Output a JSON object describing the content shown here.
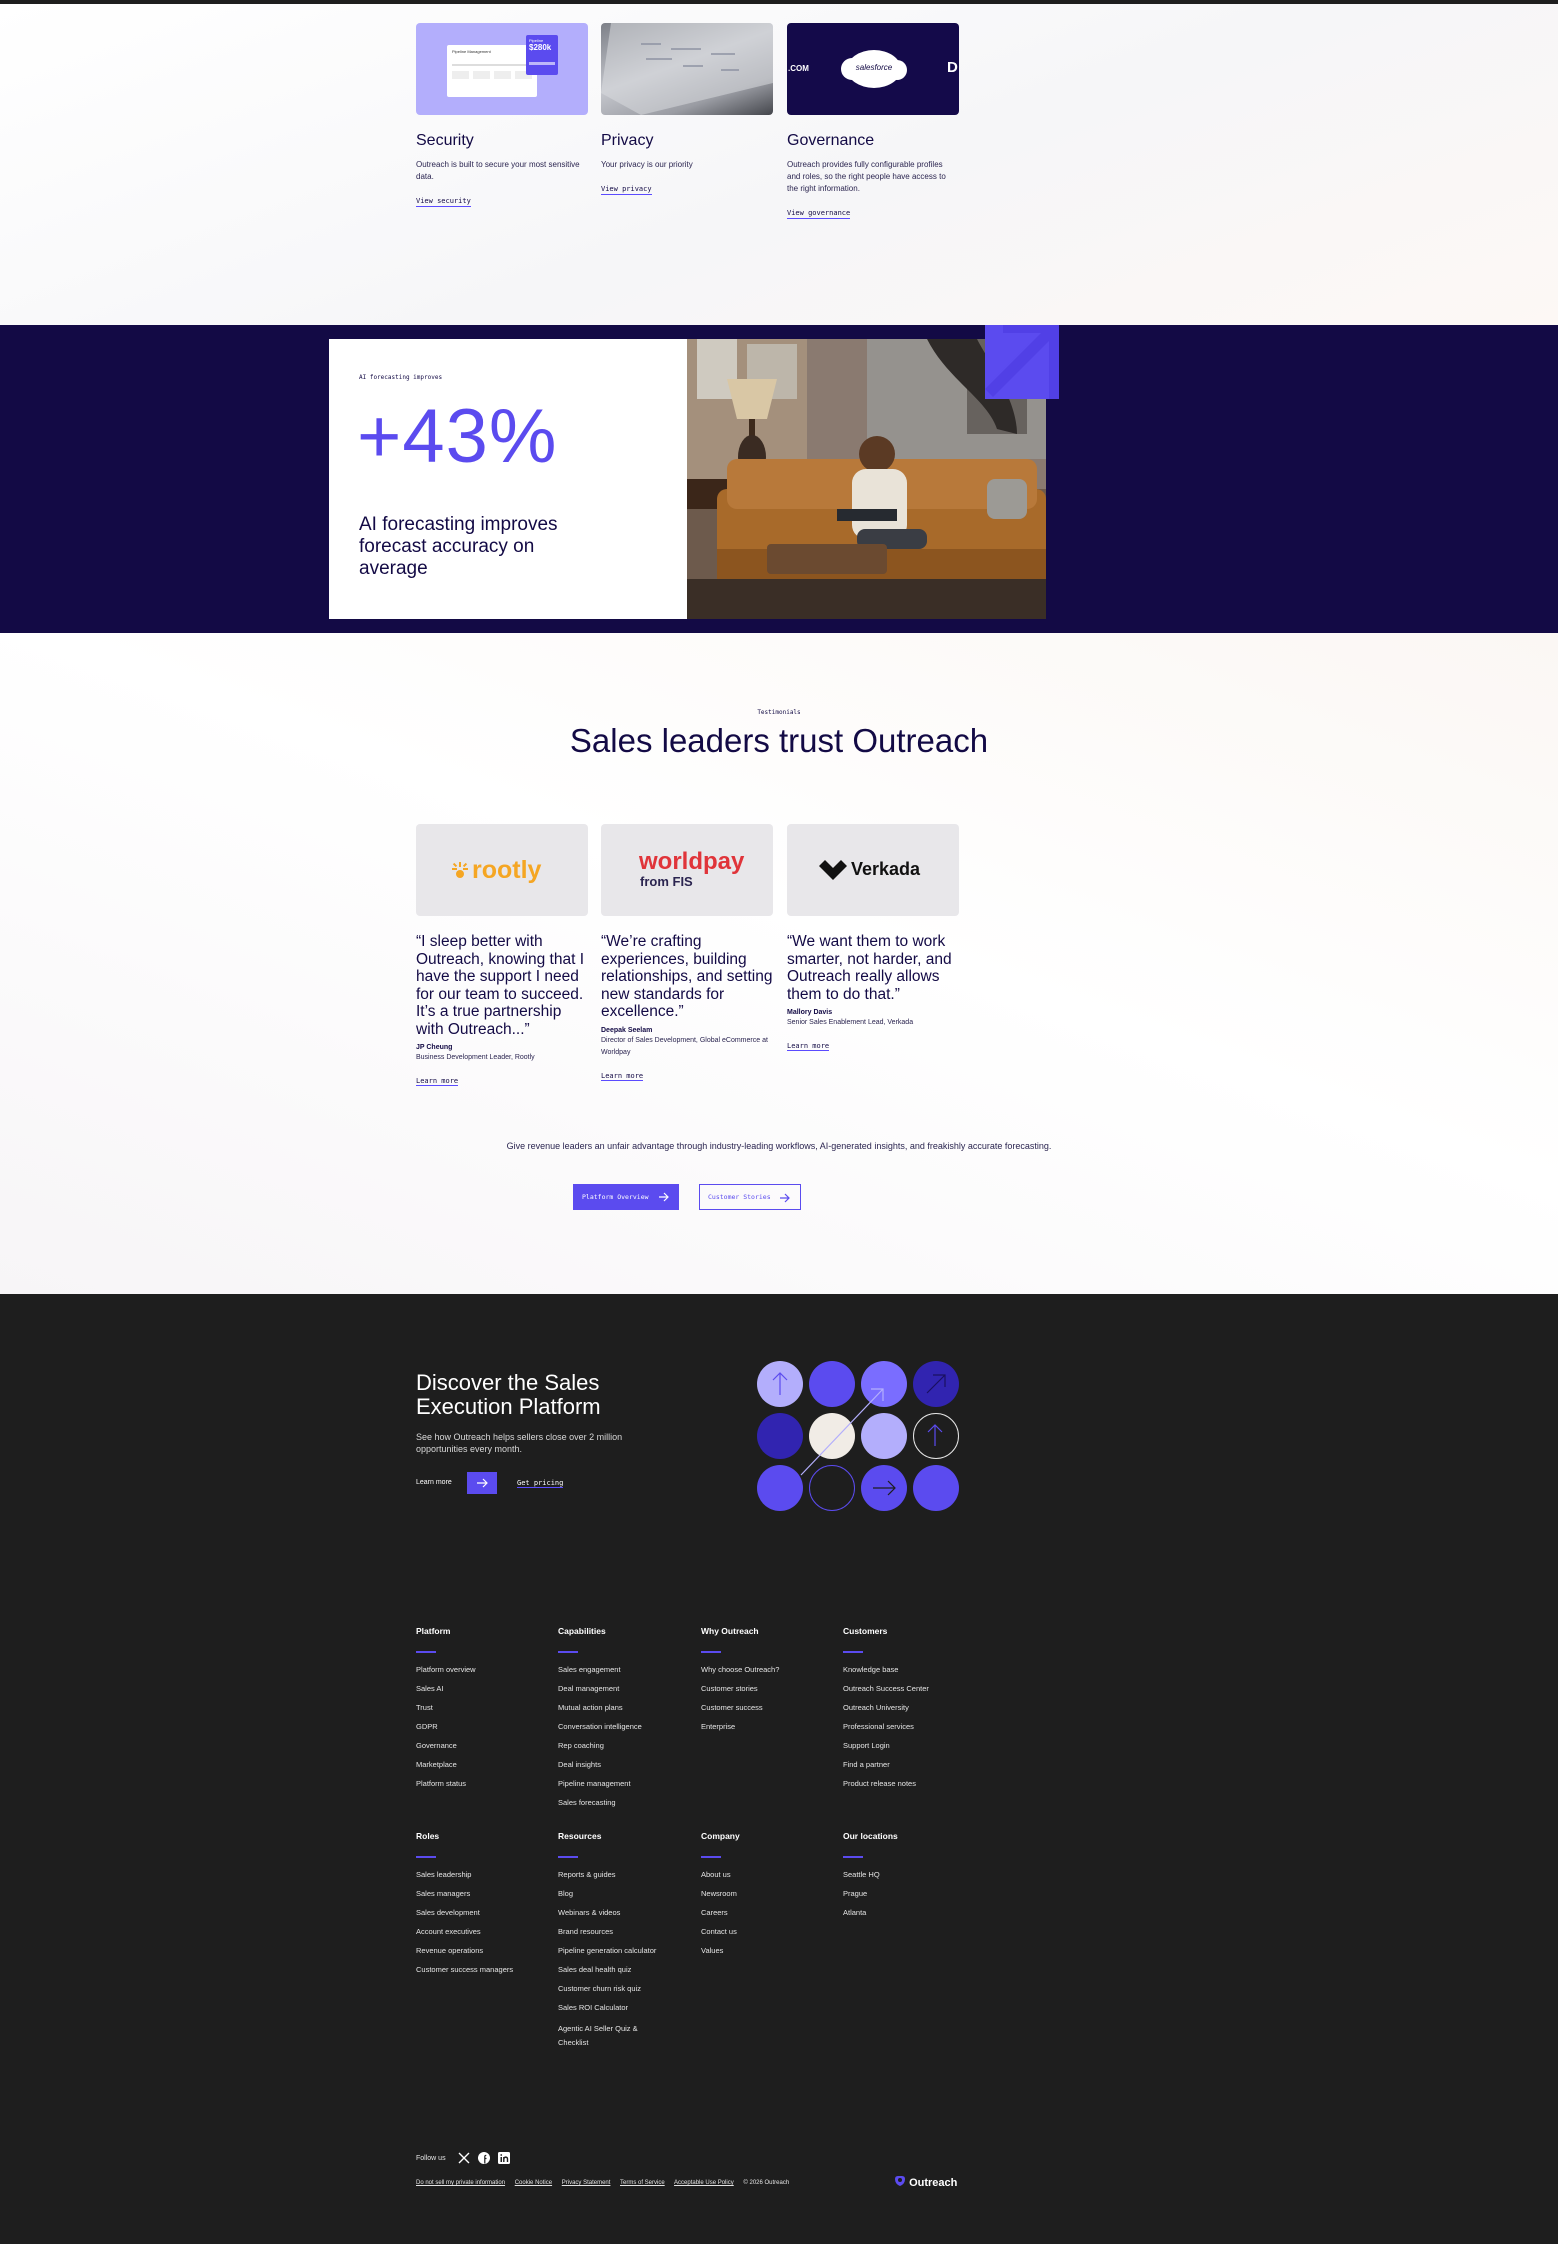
{
  "trust": {
    "cards": [
      {
        "title": "Security",
        "body": "Outreach is built to secure your most sensitive data.",
        "link": "View security"
      },
      {
        "title": "Privacy",
        "body": "Your privacy is our priority",
        "link": "View privacy"
      },
      {
        "title": "Governance",
        "body": "Outreach provides fully configurable profiles and roles, so the right people have access to the right information.",
        "link": "View governance"
      }
    ],
    "security_thumb": {
      "panel_title": "Pipeline Management",
      "amount": "$280k",
      "amount_label": "Pipeline"
    },
    "governance_thumb": {
      "left_text": ".COM",
      "logo_text": "salesforce",
      "right_text": "D"
    }
  },
  "stat": {
    "eyebrow": "AI forecasting improves",
    "value": "+43%",
    "description": "AI forecasting improves forecast accuracy on average"
  },
  "testimonials": {
    "eyebrow": "Testimonials",
    "heading": "Sales leaders trust Outreach",
    "items": [
      {
        "logo": "rootly",
        "quote": "“I sleep better with Outreach, knowing that I have the support I need for our team to succeed. It’s a true partnership with Outreach...”",
        "name": "JP Cheung",
        "role": "Business Development Leader, Rootly",
        "link": "Learn more"
      },
      {
        "logo": "worldpay",
        "logo_sub": "from FIS",
        "quote": "“We’re crafting experiences, building relationships, and setting new standards for excellence.”",
        "name": "Deepak Seelam",
        "role": "Director of Sales Development, Global eCommerce at Worldpay",
        "link": "Learn more"
      },
      {
        "logo": "Verkada",
        "quote": "“We want them to work smarter, not harder, and Outreach really allows them to do that.”",
        "name": "Mallory Davis",
        "role": "Senior Sales Enablement Lead, Verkada",
        "link": "Learn more"
      }
    ],
    "blurb": "Give revenue leaders an unfair advantage through industry-leading workflows, AI-generated insights, and freakishly accurate forecasting.",
    "primary_button": "Platform Overview",
    "secondary_button": "Customer Stories"
  },
  "footer": {
    "discover": {
      "heading": "Discover the Sales Execution Platform",
      "body": "See how Outreach helps sellers close over 2 million opportunities every month.",
      "learn_more": "Learn more",
      "pricing": "Get pricing"
    },
    "columns": [
      {
        "title": "Platform",
        "items": [
          "Platform overview",
          "Sales AI",
          "Trust",
          "GDPR",
          "Governance",
          "Marketplace",
          "Platform status"
        ]
      },
      {
        "title": "Capabilities",
        "items": [
          "Sales engagement",
          "Deal management",
          "Mutual action plans",
          "Conversation intelligence",
          "Rep coaching",
          "Deal insights",
          "Pipeline management",
          "Sales forecasting"
        ]
      },
      {
        "title": "Why Outreach",
        "items": [
          "Why choose Outreach?",
          "Customer stories",
          "Customer success",
          "Enterprise"
        ]
      },
      {
        "title": "Customers",
        "items": [
          "Knowledge base",
          "Outreach Success Center",
          "Outreach University",
          "Professional services",
          "Support Login",
          "Find a partner",
          "Product release notes"
        ]
      },
      {
        "title": "Roles",
        "items": [
          "Sales leadership",
          "Sales managers",
          "Sales development",
          "Account executives",
          "Revenue operations",
          "Customer success managers"
        ]
      },
      {
        "title": "Resources",
        "items": [
          "Reports & guides",
          "Blog",
          "Webinars & videos",
          "Brand resources",
          "Pipeline generation calculator",
          "Sales deal health quiz",
          "Customer churn risk quiz",
          "Sales ROI Calculator",
          "Agentic AI Seller Quiz & Checklist"
        ]
      },
      {
        "title": "Company",
        "items": [
          "About us",
          "Newsroom",
          "Careers",
          "Contact us",
          "Values"
        ]
      },
      {
        "title": "Our locations",
        "items": [
          "Seattle HQ",
          "Prague",
          "Atlanta"
        ]
      }
    ],
    "follow_label": "Follow us",
    "legal_links": [
      "Do not sell my private information",
      "Cookie Notice",
      "Privacy Statement",
      "Terms of Service",
      "Acceptable Use Policy"
    ],
    "copyright": "© 2026 Outreach",
    "brand": "Outreach"
  },
  "colors": {
    "accent": "#5b4bef",
    "navy": "#130a45",
    "footer_bg": "#1e1e1e",
    "logo_bg": "#e8e7ea"
  }
}
